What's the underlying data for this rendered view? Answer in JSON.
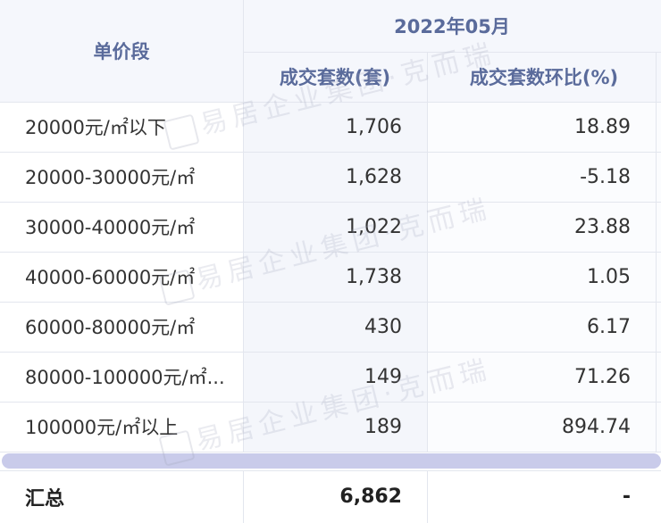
{
  "table": {
    "header": {
      "col0": "单价段",
      "period": "2022年05月",
      "col1": "成交套数(套)",
      "col2": "成交套数环比(%)"
    },
    "rows": [
      {
        "range": "20000元/㎡以下",
        "units": "1,706",
        "mom": "18.89"
      },
      {
        "range": "20000-30000元/㎡",
        "units": "1,628",
        "mom": "-5.18"
      },
      {
        "range": "30000-40000元/㎡",
        "units": "1,022",
        "mom": "23.88"
      },
      {
        "range": "40000-60000元/㎡",
        "units": "1,738",
        "mom": "1.05"
      },
      {
        "range": "60000-80000元/㎡",
        "units": "430",
        "mom": "6.17"
      },
      {
        "range": "80000-100000元/㎡...",
        "units": "149",
        "mom": "71.26"
      },
      {
        "range": "100000元/㎡以上",
        "units": "189",
        "mom": "894.74"
      }
    ],
    "total": {
      "label": "汇总",
      "units": "6,862",
      "mom": "-"
    }
  },
  "watermark": {
    "text": "易居企业集团·克而瑞"
  }
}
